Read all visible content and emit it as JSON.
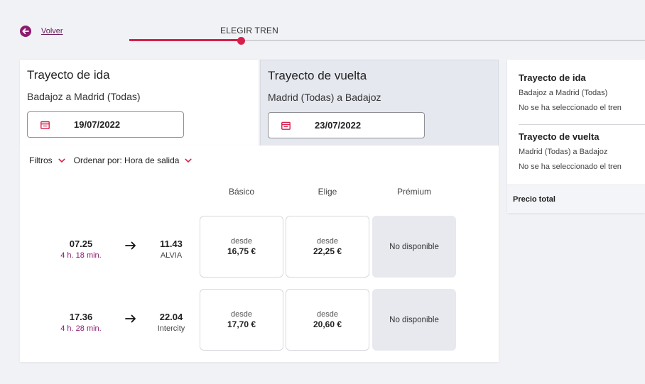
{
  "header": {
    "back_label": "Volver",
    "step_title": "ELEGIR TREN"
  },
  "tabs": {
    "ida": {
      "title": "Trayecto de ida",
      "route": "Badajoz a Madrid (Todas)",
      "date": "19/07/2022"
    },
    "vuelta": {
      "title": "Trayecto de vuelta",
      "route": "Madrid (Todas) a Badajoz",
      "date": "23/07/2022"
    }
  },
  "results": {
    "filters_label": "Filtros",
    "sort_label": "Ordenar por: Hora de salida",
    "columns": [
      "Básico",
      "Elige",
      "Prémium"
    ],
    "trains": [
      {
        "departure": "07.25",
        "duration": "4 h. 18 min.",
        "arrival": "11.43",
        "train": "ALVIA",
        "fares": [
          {
            "prefix": "desde",
            "price": "16,75 €",
            "available": true
          },
          {
            "prefix": "desde",
            "price": "22,25 €",
            "available": true
          },
          {
            "label": "No disponible",
            "available": false
          }
        ]
      },
      {
        "departure": "17.36",
        "duration": "4 h. 28 min.",
        "arrival": "22.04",
        "train": "Intercity",
        "fares": [
          {
            "prefix": "desde",
            "price": "17,70 €",
            "available": true
          },
          {
            "prefix": "desde",
            "price": "20,60 €",
            "available": true
          },
          {
            "label": "No disponible",
            "available": false
          }
        ]
      }
    ]
  },
  "summary": {
    "ida": {
      "title": "Trayecto de ida",
      "route": "Badajoz a Madrid (Todas)",
      "status": "No se ha seleccionado el tren"
    },
    "vuelta": {
      "title": "Trayecto de vuelta",
      "route": "Madrid (Todas) a Badajoz",
      "status": "No se ha seleccionado el tren"
    },
    "total_label": "Precio total"
  },
  "colors": {
    "accent": "#d6204b",
    "brand": "#8c1b6e",
    "background": "#f1f2f6"
  },
  "progress": {
    "completed_fraction": 0.22
  },
  "icons": [
    "arrow-left-icon",
    "calendar-icon",
    "chevron-down-icon",
    "arrow-right-icon"
  ]
}
